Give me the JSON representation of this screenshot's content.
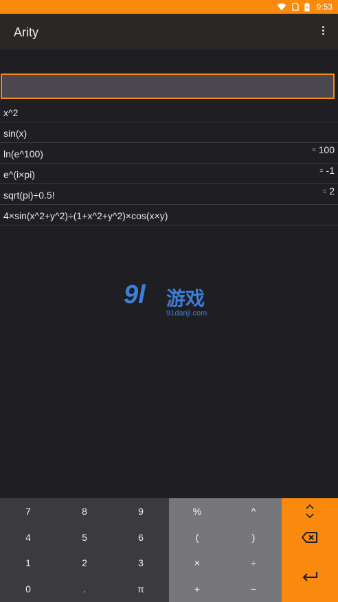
{
  "status": {
    "time": "9:53"
  },
  "app": {
    "title": "Arity"
  },
  "input": {
    "value": ""
  },
  "history": [
    {
      "expr": "x^2",
      "result": ""
    },
    {
      "expr": "sin(x)",
      "result": ""
    },
    {
      "expr": "ln(e^100)",
      "result": "100"
    },
    {
      "expr": "e^(i×pi)",
      "result": "-1"
    },
    {
      "expr": "sqrt(pi)÷0.5!",
      "result": "2"
    },
    {
      "expr": "4×sin(x^2+y^2)÷(1+x^2+y^2)×cos(x×y)",
      "result": ""
    }
  ],
  "result_prefix": "=",
  "watermark": {
    "logo": "9l",
    "text": "游戏",
    "url": "91danji.com"
  },
  "keypad": {
    "numbers": [
      "7",
      "8",
      "9",
      "4",
      "5",
      "6",
      "1",
      "2",
      "3",
      "0",
      ".",
      "π"
    ],
    "operators": [
      "%",
      "^",
      "(",
      ")",
      "×",
      "÷",
      "+",
      "−"
    ]
  },
  "icons": {
    "wifi": "wifi-icon",
    "battery": "battery-icon",
    "menu": "more-vert-icon",
    "expand": "expand-icon",
    "backspace": "backspace-icon",
    "enter": "enter-icon"
  },
  "colors": {
    "accent": "#f98a0d",
    "background": "#1f1e23",
    "number_pad": "#3b3a3d",
    "operator_pad": "#77767a"
  }
}
